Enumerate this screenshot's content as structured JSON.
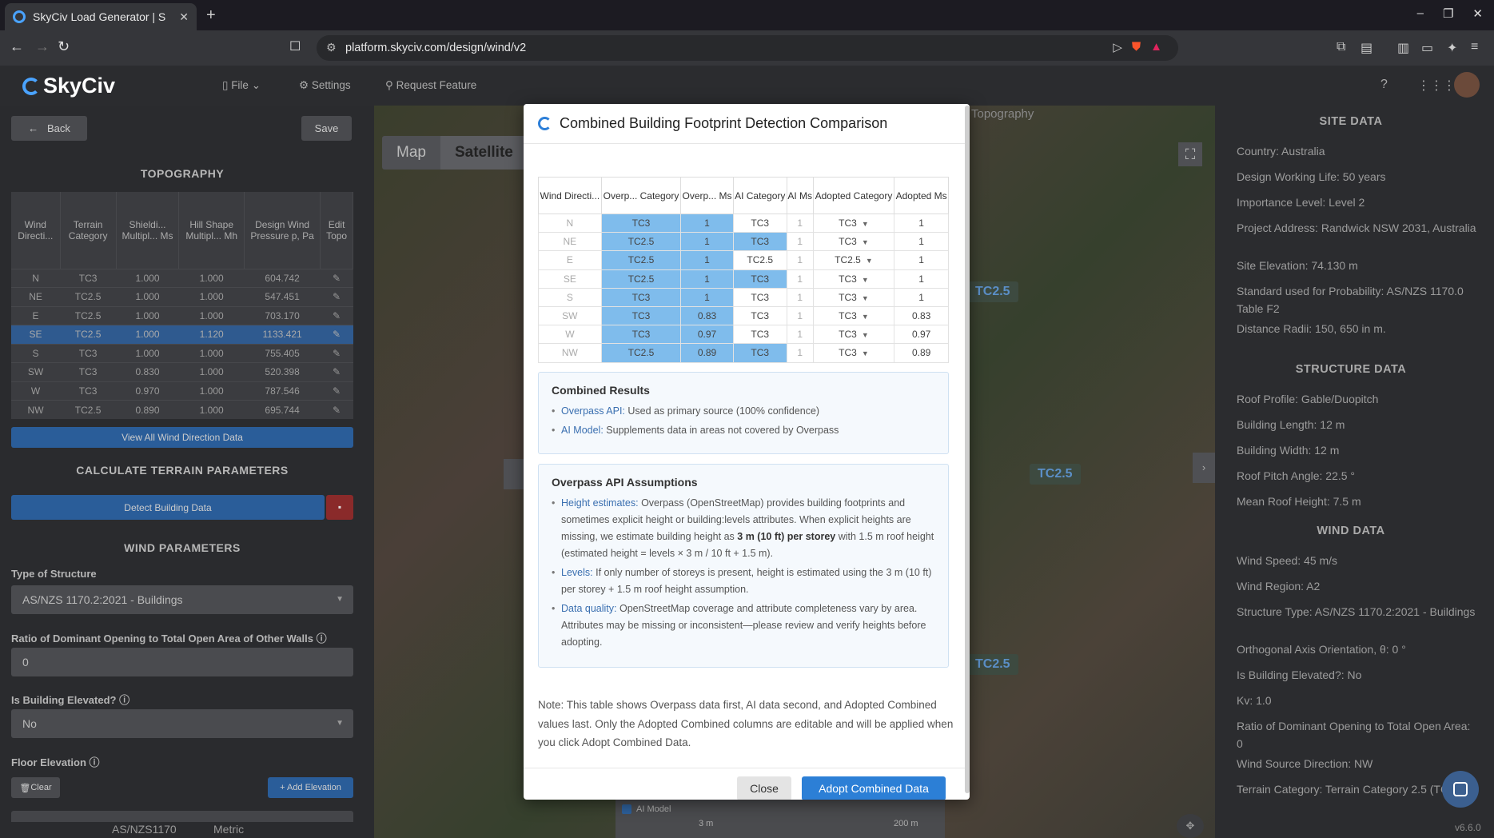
{
  "browser": {
    "tab_title": "SkyCiv Load Generator | S",
    "url": "platform.skyciv.com/design/wind/v2"
  },
  "app": {
    "logo": "SkyCiv",
    "menu": {
      "file": "File",
      "settings": "Settings",
      "request": "Request Feature"
    }
  },
  "left": {
    "back": "Back",
    "save": "Save",
    "topography_title": "TOPOGRAPHY",
    "table_headers": [
      "Wind Directi...",
      "Terrain Category",
      "Shieldi... Multipl... Ms",
      "Hill Shape Multipl... Mh",
      "Design Wind Pressure p, Pa",
      "Edit Topo"
    ],
    "rows": [
      {
        "dir": "N",
        "terrain": "TC3",
        "ms": "1.000",
        "mh": "1.000",
        "p": "604.742"
      },
      {
        "dir": "NE",
        "terrain": "TC2.5",
        "ms": "1.000",
        "mh": "1.000",
        "p": "547.451"
      },
      {
        "dir": "E",
        "terrain": "TC2.5",
        "ms": "1.000",
        "mh": "1.000",
        "p": "703.170"
      },
      {
        "dir": "SE",
        "terrain": "TC2.5",
        "ms": "1.000",
        "mh": "1.120",
        "p": "1133.421"
      },
      {
        "dir": "S",
        "terrain": "TC3",
        "ms": "1.000",
        "mh": "1.000",
        "p": "755.405"
      },
      {
        "dir": "SW",
        "terrain": "TC3",
        "ms": "0.830",
        "mh": "1.000",
        "p": "520.398"
      },
      {
        "dir": "W",
        "terrain": "TC3",
        "ms": "0.970",
        "mh": "1.000",
        "p": "787.546"
      },
      {
        "dir": "NW",
        "terrain": "TC2.5",
        "ms": "0.890",
        "mh": "1.000",
        "p": "695.744"
      }
    ],
    "view_all": "View All Wind Direction Data",
    "calc_title": "CALCULATE TERRAIN PARAMETERS",
    "detect": "Detect Building Data",
    "wind_title": "WIND PARAMETERS",
    "type_label": "Type of Structure",
    "type_value": "AS/NZS 1170.2:2021 - Buildings",
    "ratio_label": "Ratio of Dominant Opening to Total Open Area of Other Walls",
    "ratio_value": "0",
    "elevated_label": "Is Building Elevated?",
    "elevated_value": "No",
    "floor_label": "Floor Elevation",
    "clear": "Clear",
    "add_elev": "+ Add Elevation",
    "footer_std": "AS/NZS1170",
    "footer_units": "Metric"
  },
  "map": {
    "map_btn": "Map",
    "sat_btn": "Satellite",
    "topo_tab": "Topography",
    "labels": [
      "TC2.5",
      "TC2.5",
      "TC2.5"
    ],
    "ai_model": "AI Model",
    "scale1": "3 m",
    "scale2": "200 m"
  },
  "modal": {
    "title": "Combined Building Footprint Detection Comparison",
    "headers": [
      "Wind Directi...",
      "Overp... Category",
      "Overp... Ms",
      "AI Category",
      "AI Ms",
      "Adopted Category",
      "Adopted Ms"
    ],
    "rows": [
      {
        "dir": "N",
        "oc": "TC3",
        "om": "1",
        "ac": "TC3",
        "am": "1",
        "adc": "TC3",
        "adm": "1"
      },
      {
        "dir": "NE",
        "oc": "TC2.5",
        "om": "1",
        "ac": "TC3",
        "am": "1",
        "adc": "TC3",
        "adm": "1"
      },
      {
        "dir": "E",
        "oc": "TC2.5",
        "om": "1",
        "ac": "TC2.5",
        "am": "1",
        "adc": "TC2.5",
        "adm": "1"
      },
      {
        "dir": "SE",
        "oc": "TC2.5",
        "om": "1",
        "ac": "TC3",
        "am": "1",
        "adc": "TC3",
        "adm": "1"
      },
      {
        "dir": "S",
        "oc": "TC3",
        "om": "1",
        "ac": "TC3",
        "am": "1",
        "adc": "TC3",
        "adm": "1"
      },
      {
        "dir": "SW",
        "oc": "TC3",
        "om": "0.83",
        "ac": "TC3",
        "am": "1",
        "adc": "TC3",
        "adm": "0.83"
      },
      {
        "dir": "W",
        "oc": "TC3",
        "om": "0.97",
        "ac": "TC3",
        "am": "1",
        "adc": "TC3",
        "adm": "0.97"
      },
      {
        "dir": "NW",
        "oc": "TC2.5",
        "om": "0.89",
        "ac": "TC3",
        "am": "1",
        "adc": "TC3",
        "adm": "0.89"
      }
    ],
    "results_title": "Combined Results",
    "res1_b": "Overpass API:",
    "res1": "Used as primary source (100% confidence)",
    "res2_b": "AI Model:",
    "res2": "Supplements data in areas not covered by Overpass",
    "assump_title": "Overpass API Assumptions",
    "a1_b": "Height estimates:",
    "a1": "Overpass (OpenStreetMap) provides building footprints and sometimes explicit height or building:levels attributes. When explicit heights are missing, we estimate building height as",
    "a1_strong": "3 m (10 ft) per storey",
    "a1_end": "with 1.5 m roof height (estimated height = levels × 3 m / 10 ft + 1.5 m).",
    "a2_b": "Levels:",
    "a2": "If only number of storeys is present, height is estimated using the 3 m (10 ft) per storey + 1.5 m roof height assumption.",
    "a3_b": "Data quality:",
    "a3": "OpenStreetMap coverage and attribute completeness vary by area. Attributes may be missing or inconsistent—please review and verify heights before adopting.",
    "note": "Note: This table shows Overpass data first, AI data second, and Adopted Combined values last. Only the Adopted Combined columns are editable and will be applied when you click Adopt Combined Data.",
    "close": "Close",
    "adopt": "Adopt Combined Data"
  },
  "right": {
    "site_title": "SITE DATA",
    "site": [
      "Country: Australia",
      "Design Working Life: 50 years",
      "Importance Level: Level 2",
      "Project Address: Randwick NSW 2031, Australia",
      "Site Elevation: 74.130 m",
      "Standard used for Probability: AS/NZS 1170.0 Table F2",
      "Distance Radii: 150, 650 in m."
    ],
    "structure_title": "STRUCTURE DATA",
    "structure": [
      "Roof Profile: Gable/Duopitch",
      "Building Length: 12 m",
      "Building Width: 12 m",
      "Roof Pitch Angle: 22.5 °",
      "Mean Roof Height: 7.5 m"
    ],
    "wind_title": "WIND DATA",
    "wind": [
      "Wind Speed: 45 m/s",
      "Wind Region: A2",
      "Structure Type: AS/NZS 1170.2:2021 - Buildings",
      "Orthogonal Axis Orientation, θ: 0 °",
      "Is Building Elevated?: No",
      "Kv: 1.0",
      "Ratio of Dominant Opening to Total Open Area: 0",
      "Wind Source Direction: NW",
      "Terrain Category: Terrain Category 2.5 (TC2.5)"
    ],
    "version": "v6.6.0"
  }
}
